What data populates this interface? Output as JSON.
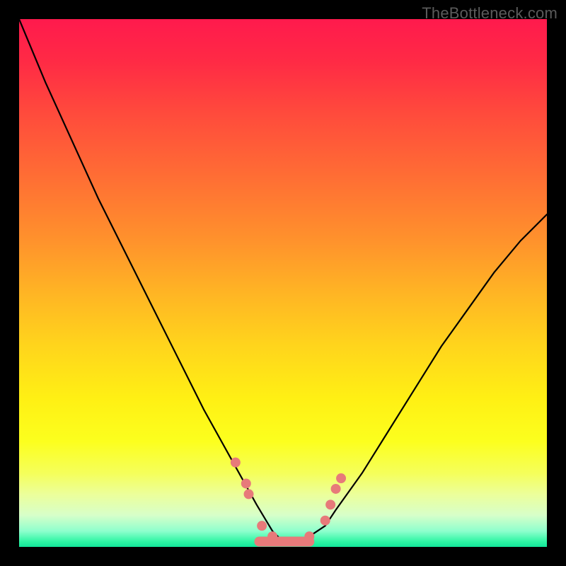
{
  "watermark": {
    "text": "TheBottleneck.com"
  },
  "chart_data": {
    "type": "line",
    "title": "",
    "xlabel": "",
    "ylabel": "",
    "xlim": [
      0,
      100
    ],
    "ylim": [
      0,
      100
    ],
    "x": [
      0,
      5,
      10,
      15,
      20,
      25,
      30,
      35,
      40,
      45,
      48,
      50,
      52,
      55,
      58,
      60,
      65,
      70,
      75,
      80,
      85,
      90,
      95,
      100
    ],
    "series": [
      {
        "name": "bottleneck-curve",
        "values": [
          100,
          88,
          77,
          66,
          56,
          46,
          36,
          26,
          17,
          8,
          3,
          1,
          1,
          2,
          4,
          7,
          14,
          22,
          30,
          38,
          45,
          52,
          58,
          63
        ]
      }
    ],
    "markers": {
      "name": "highlighted-points",
      "color": "#e77a7a",
      "radius": 7,
      "points": [
        {
          "x": 41,
          "y": 16
        },
        {
          "x": 43,
          "y": 12
        },
        {
          "x": 43.5,
          "y": 10
        },
        {
          "x": 46,
          "y": 4
        },
        {
          "x": 48,
          "y": 2
        },
        {
          "x": 55,
          "y": 2
        },
        {
          "x": 58,
          "y": 5
        },
        {
          "x": 59,
          "y": 8
        },
        {
          "x": 60,
          "y": 11
        },
        {
          "x": 61,
          "y": 13
        }
      ]
    },
    "valley_segment": {
      "name": "valley-bar",
      "color": "#e77a7a",
      "x_start": 45.5,
      "x_end": 55,
      "y": 1,
      "thickness": 14
    },
    "background": {
      "type": "vertical-gradient",
      "stops": [
        {
          "pos": 0.0,
          "color": "#ff1a4d"
        },
        {
          "pos": 0.5,
          "color": "#ffb524"
        },
        {
          "pos": 0.8,
          "color": "#fcff1e"
        },
        {
          "pos": 0.94,
          "color": "#d7ffc9"
        },
        {
          "pos": 1.0,
          "color": "#13e59a"
        }
      ]
    }
  }
}
